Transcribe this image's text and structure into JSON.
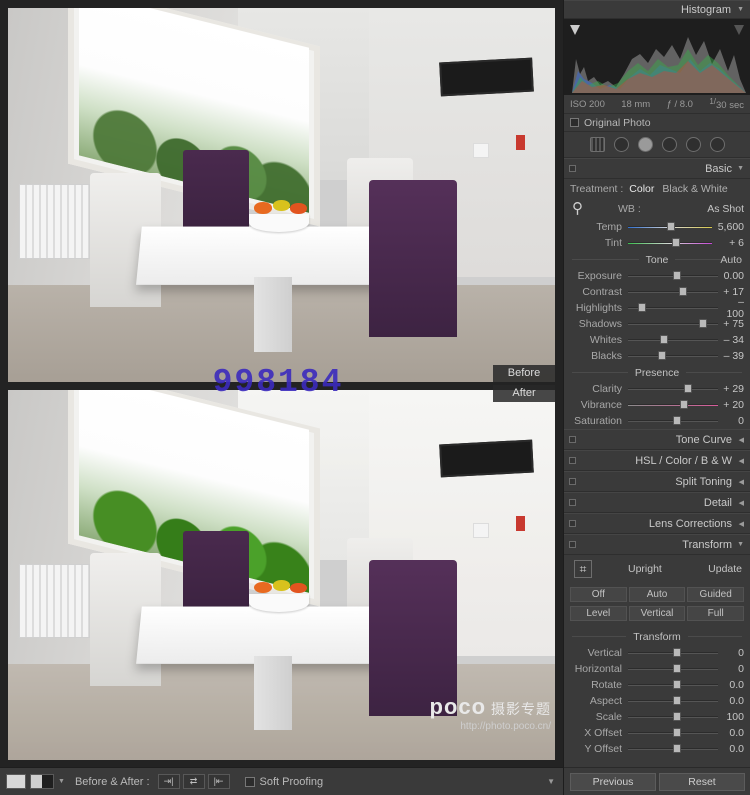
{
  "preview": {
    "before_label": "Before",
    "after_label": "After",
    "watermark": "998184",
    "poco_title": "poco",
    "poco_title_sub": " 摄影专题",
    "poco_url": "http://photo.poco.cn/"
  },
  "toolbar": {
    "before_after_label": "Before & After :",
    "soft_proofing_label": "Soft Proofing",
    "icons": [
      "copy-before-settings-icon",
      "swap-before-after-icon",
      "copy-after-settings-icon"
    ]
  },
  "right_panel": {
    "histogram": {
      "title": "Histogram",
      "iso": "ISO 200",
      "focal": "18 mm",
      "aperture": "ƒ / 8.0",
      "shutter_num": "1/",
      "shutter_den": "30 sec"
    },
    "original_photo_label": "Original Photo",
    "tools": [
      "crop-tool",
      "spot-removal-tool",
      "redeye-tool",
      "graduated-filter-tool",
      "radial-filter-tool",
      "adjustment-brush-tool"
    ],
    "basic": {
      "title": "Basic",
      "treatment_label": "Treatment :",
      "treatment_color": "Color",
      "treatment_bw": "Black & White",
      "wb_label": "WB :",
      "wb_value": "As Shot",
      "temp_label": "Temp",
      "temp_value": "5,600",
      "tint_label": "Tint",
      "tint_value": "+ 6",
      "tone_label": "Tone",
      "auto_label": "Auto",
      "sliders": [
        {
          "label": "Exposure",
          "value": "0.00",
          "pos": 50
        },
        {
          "label": "Contrast",
          "value": "+ 17",
          "pos": 57
        },
        {
          "label": "Highlights",
          "value": "– 100",
          "pos": 11
        },
        {
          "label": "Shadows",
          "value": "+ 75",
          "pos": 79
        },
        {
          "label": "Whites",
          "value": "– 34",
          "pos": 36
        },
        {
          "label": "Blacks",
          "value": "– 39",
          "pos": 33
        }
      ],
      "presence_label": "Presence",
      "presence_sliders": [
        {
          "label": "Clarity",
          "value": "+ 29",
          "pos": 62
        },
        {
          "label": "Vibrance",
          "value": "+ 20",
          "pos": 58
        },
        {
          "label": "Saturation",
          "value": "0",
          "pos": 50
        }
      ]
    },
    "sections": [
      {
        "title": "Tone Curve"
      },
      {
        "title": "HSL  /  Color  /  B & W"
      },
      {
        "title": "Split Toning"
      },
      {
        "title": "Detail"
      },
      {
        "title": "Lens Corrections"
      },
      {
        "title": "Transform"
      }
    ],
    "transform": {
      "upright_label": "Upright",
      "update_label": "Update",
      "buttons_row1": [
        "Off",
        "Auto",
        "Guided"
      ],
      "buttons_row2": [
        "Level",
        "Vertical",
        "Full"
      ],
      "group_label": "Transform",
      "sliders": [
        {
          "label": "Vertical",
          "value": "0",
          "pos": 50
        },
        {
          "label": "Horizontal",
          "value": "0",
          "pos": 50
        },
        {
          "label": "Rotate",
          "value": "0.0",
          "pos": 50
        },
        {
          "label": "Aspect",
          "value": "0.0",
          "pos": 50
        },
        {
          "label": "Scale",
          "value": "100",
          "pos": 50
        },
        {
          "label": "X Offset",
          "value": "0.0",
          "pos": 50
        },
        {
          "label": "Y Offset",
          "value": "0.0",
          "pos": 50
        }
      ]
    },
    "footer": {
      "previous_label": "Previous",
      "reset_label": "Reset"
    }
  }
}
